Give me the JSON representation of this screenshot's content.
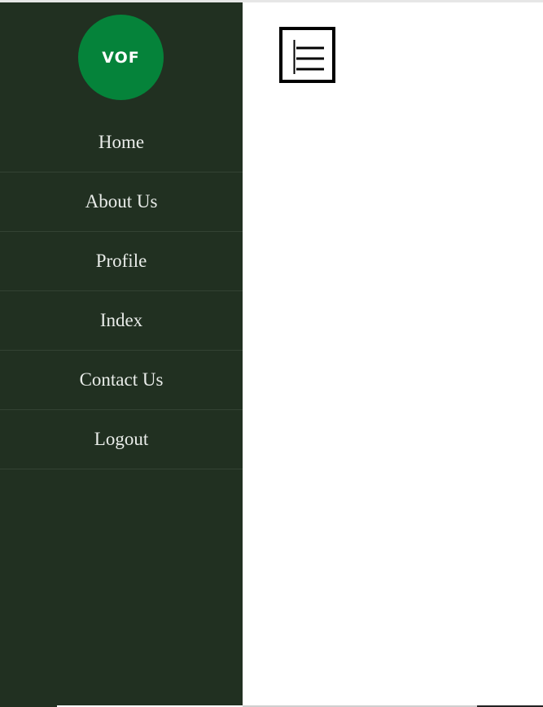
{
  "logo": {
    "text": "VOF",
    "color": "#05833a"
  },
  "sidebar": {
    "background": "#213021",
    "items": [
      {
        "label": "Home"
      },
      {
        "label": "About Us"
      },
      {
        "label": "Profile"
      },
      {
        "label": "Index"
      },
      {
        "label": "Contact Us"
      },
      {
        "label": "Logout"
      }
    ]
  },
  "toolbar": {
    "menu_icon": "hamburger-menu-icon"
  }
}
